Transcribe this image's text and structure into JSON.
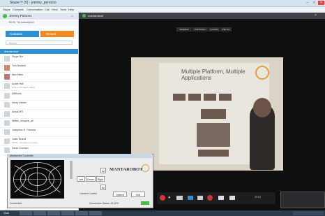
{
  "window": {
    "title": "Skype™ (5) - jeremy_perezoo"
  },
  "menu": [
    "Skype",
    "Contacts",
    "Conversation",
    "Call",
    "View",
    "Tools",
    "Help"
  ],
  "profile": {
    "name": "Jeremy Parsons"
  },
  "credit": {
    "text": "$3.95 · No subscription"
  },
  "tabs": {
    "contacts": "Contacts",
    "recent": "Recent"
  },
  "search": {
    "placeholder": "Search"
  },
  "group": {
    "label": "Mantarobot"
  },
  "contacts": [
    {
      "name": "Skype Bot",
      "sub": ""
    },
    {
      "name": "Tom Nowicki",
      "sub": ""
    },
    {
      "name": "Alec Miles",
      "sub": ""
    },
    {
      "name": "Austin Hall",
      "sub": "Online with Skype calling"
    },
    {
      "name": "MBftools",
      "sub": ""
    },
    {
      "name": "Henry Steven",
      "sub": ""
    },
    {
      "name": "AnnaDIRT",
      "sub": ""
    },
    {
      "name": "Mellon_rossjohn_all",
      "sub": ""
    },
    {
      "name": "Josephine R. Parsons",
      "sub": ""
    },
    {
      "name": "Justin Brandt",
      "sub": "Mobile - Working on remote"
    },
    {
      "name": "Sarah Guzman",
      "sub": ""
    }
  ],
  "video": {
    "header_title": "mantarobot8",
    "toolbar": [
      "Snapshot",
      "Full Screen",
      "Controls",
      "Pop out"
    ],
    "slide_title": "Multiple Platform, Multiple Applications",
    "call_time": "20:10"
  },
  "controller": {
    "title": "Mantarobot Controller",
    "buttons": {
      "left": "Left",
      "center": "Center",
      "right": "Right",
      "up": "Up",
      "down": "Dn",
      "options": "Options",
      "exit": "Exit"
    },
    "camera_label": "Camera Control",
    "status_left": "Connected",
    "status_right": "Connection Status: 95.10%",
    "logo_text": "MANTAROBOT"
  },
  "taskbar": {
    "start": "Start"
  },
  "colors": {
    "skype_blue": "#2f8fd1",
    "recent_orange": "#f08a24",
    "video_bg": "#0f0f0f"
  }
}
